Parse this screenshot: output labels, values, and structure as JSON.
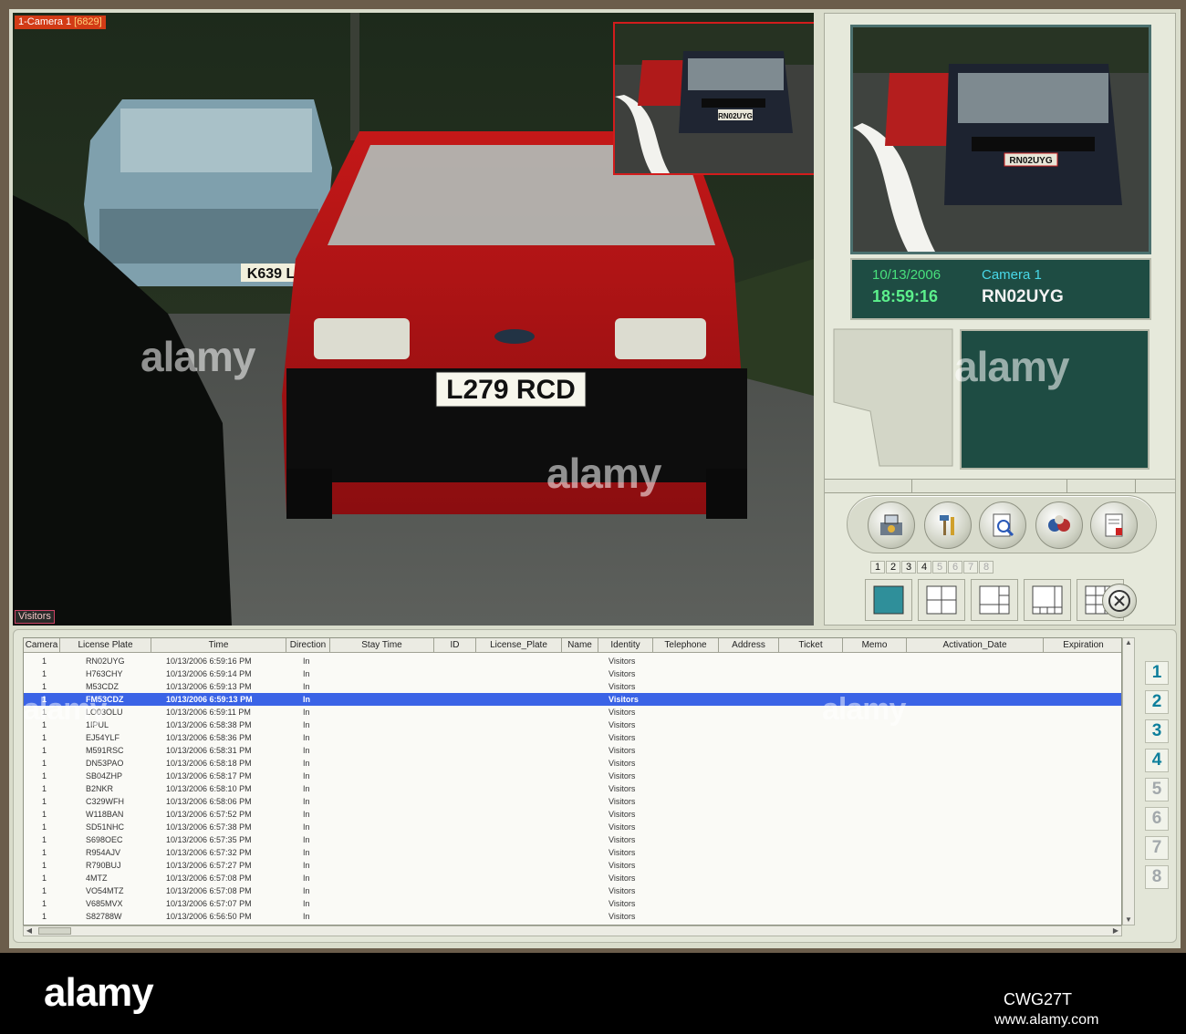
{
  "camera_view": {
    "label_prefix": "1-Camera 1",
    "label_frame": "[6829]",
    "visitors_tag": "Visitors",
    "main_plate": "L279 RCD",
    "side_plate": "K639 L",
    "inset_plate": "RN02UYG"
  },
  "capture": {
    "plate_in_image": "RN02UYG",
    "date": "10/13/2006",
    "camera": "Camera 1",
    "time": "18:59:16",
    "plate": "RN02UYG"
  },
  "page_tabs": [
    {
      "label": "1",
      "active": true
    },
    {
      "label": "2",
      "active": true
    },
    {
      "label": "3",
      "active": true
    },
    {
      "label": "4",
      "active": true
    },
    {
      "label": "5",
      "active": false
    },
    {
      "label": "6",
      "active": false
    },
    {
      "label": "7",
      "active": false
    },
    {
      "label": "8",
      "active": false
    }
  ],
  "table": {
    "columns": [
      "Camera",
      "License Plate",
      "Time",
      "Direction",
      "Stay Time",
      "ID",
      "License_Plate",
      "Name",
      "Identity",
      "Telephone",
      "Address",
      "Ticket",
      "Memo",
      "Activation_Date",
      "Expiration"
    ],
    "rows": [
      {
        "camera": "1",
        "plate": "RN02UYG",
        "time": "10/13/2006 6:59:16 PM",
        "direction": "In",
        "identity": "Visitors"
      },
      {
        "camera": "1",
        "plate": "H763CHY",
        "time": "10/13/2006 6:59:14 PM",
        "direction": "In",
        "identity": "Visitors"
      },
      {
        "camera": "1",
        "plate": "M53CDZ",
        "time": "10/13/2006 6:59:13 PM",
        "direction": "In",
        "identity": "Visitors"
      },
      {
        "camera": "1",
        "plate": "FM53CDZ",
        "time": "10/13/2006 6:59:13 PM",
        "direction": "In",
        "identity": "Visitors",
        "selected": true
      },
      {
        "camera": "1",
        "plate": "LO03OLU",
        "time": "10/13/2006 6:59:11 PM",
        "direction": "In",
        "identity": "Visitors"
      },
      {
        "camera": "1",
        "plate": "1IPUL",
        "time": "10/13/2006 6:58:38 PM",
        "direction": "In",
        "identity": "Visitors"
      },
      {
        "camera": "1",
        "plate": "EJ54YLF",
        "time": "10/13/2006 6:58:36 PM",
        "direction": "In",
        "identity": "Visitors"
      },
      {
        "camera": "1",
        "plate": "M591RSC",
        "time": "10/13/2006 6:58:31 PM",
        "direction": "In",
        "identity": "Visitors"
      },
      {
        "camera": "1",
        "plate": "DN53PAO",
        "time": "10/13/2006 6:58:18 PM",
        "direction": "In",
        "identity": "Visitors"
      },
      {
        "camera": "1",
        "plate": "SB04ZHP",
        "time": "10/13/2006 6:58:17 PM",
        "direction": "In",
        "identity": "Visitors"
      },
      {
        "camera": "1",
        "plate": "B2NKR",
        "time": "10/13/2006 6:58:10 PM",
        "direction": "In",
        "identity": "Visitors"
      },
      {
        "camera": "1",
        "plate": "C329WFH",
        "time": "10/13/2006 6:58:06 PM",
        "direction": "In",
        "identity": "Visitors"
      },
      {
        "camera": "1",
        "plate": "W118BAN",
        "time": "10/13/2006 6:57:52 PM",
        "direction": "In",
        "identity": "Visitors"
      },
      {
        "camera": "1",
        "plate": "SD51NHC",
        "time": "10/13/2006 6:57:38 PM",
        "direction": "In",
        "identity": "Visitors"
      },
      {
        "camera": "1",
        "plate": "S698OEC",
        "time": "10/13/2006 6:57:35 PM",
        "direction": "In",
        "identity": "Visitors"
      },
      {
        "camera": "1",
        "plate": "R954AJV",
        "time": "10/13/2006 6:57:32 PM",
        "direction": "In",
        "identity": "Visitors"
      },
      {
        "camera": "1",
        "plate": "R790BUJ",
        "time": "10/13/2006 6:57:27 PM",
        "direction": "In",
        "identity": "Visitors"
      },
      {
        "camera": "1",
        "plate": "4MTZ",
        "time": "10/13/2006 6:57:08 PM",
        "direction": "In",
        "identity": "Visitors"
      },
      {
        "camera": "1",
        "plate": "VO54MTZ",
        "time": "10/13/2006 6:57:08 PM",
        "direction": "In",
        "identity": "Visitors"
      },
      {
        "camera": "1",
        "plate": "V685MVX",
        "time": "10/13/2006 6:57:07 PM",
        "direction": "In",
        "identity": "Visitors"
      },
      {
        "camera": "1",
        "plate": "S82788W",
        "time": "10/13/2006 6:56:50 PM",
        "direction": "In",
        "identity": "Visitors"
      }
    ]
  },
  "camera_selector": [
    {
      "label": "1",
      "active": true
    },
    {
      "label": "2",
      "active": true
    },
    {
      "label": "3",
      "active": true
    },
    {
      "label": "4",
      "active": true
    },
    {
      "label": "5",
      "active": false
    },
    {
      "label": "6",
      "active": false
    },
    {
      "label": "7",
      "active": false
    },
    {
      "label": "8",
      "active": false
    }
  ],
  "toolbar_icons": [
    "camera-settings-icon",
    "tools-icon",
    "search-document-icon",
    "film-reel-icon",
    "report-icon"
  ],
  "watermark": {
    "text": "alamy",
    "image_id": "CWG27T",
    "url": "www.alamy.com"
  },
  "colors": {
    "selection": "#3a63e6",
    "info_panel": "#1e4c43",
    "camera_label": "#d23b16",
    "inset_border": "#d21c1c"
  }
}
